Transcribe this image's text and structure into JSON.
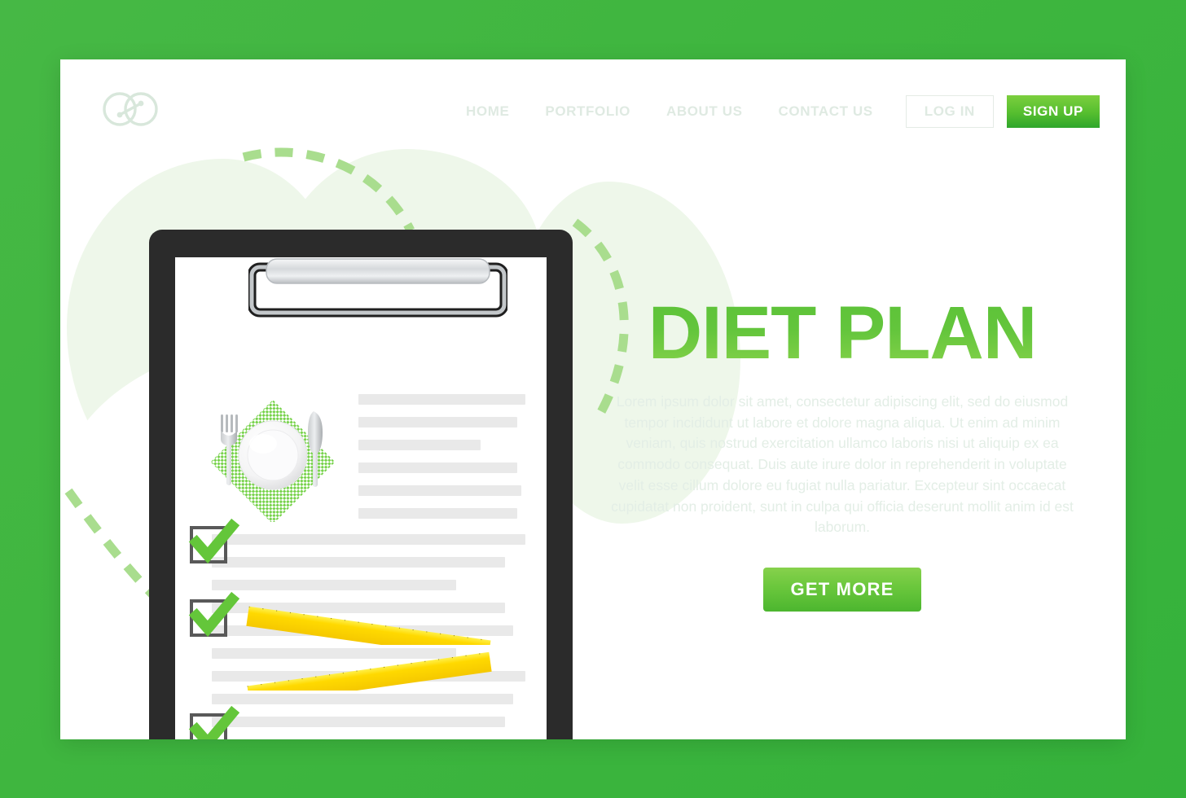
{
  "brand": {
    "logo_icon": "infinity-loop-logo"
  },
  "nav": {
    "items": [
      {
        "label": "HOME"
      },
      {
        "label": "PORTFOLIO"
      },
      {
        "label": "ABOUT US"
      },
      {
        "label": "CONTACT US"
      }
    ],
    "login_label": "LOG IN",
    "signup_label": "SIGN UP"
  },
  "hero": {
    "title": "DIET PLAN",
    "paragraph": "Lorem ipsum dolor sit amet, consectetur adipiscing elit, sed do eiusmod tempor incididunt ut labore et dolore magna aliqua. Ut enim ad minim veniam, quis nostrud exercitation ullamco laboris nisi ut aliquip ex ea commodo consequat. Duis aute irure dolor in reprehenderit in voluptate velit esse cillum dolore eu fugiat nulla pariatur. Excepteur sint occaecat cupidatat non proident, sunt in culpa qui officia deserunt mollit anim id est laborum.",
    "cta_label": "GET MORE"
  },
  "illustration": {
    "name": "diet-plan-clipboard",
    "clipboard_icon": "clipboard-icon",
    "plate_icon": "plate-icon",
    "fork_icon": "fork-icon",
    "knife_icon": "knife-icon",
    "napkin_icon": "checkered-napkin-icon",
    "checkmark_icon": "checkmark-icon",
    "measuring_tape_icon": "measuring-tape-icon",
    "checkbox_count": 3,
    "text_line_widths": [
      205,
      195,
      150,
      195,
      200,
      195,
      385,
      360,
      300,
      360,
      370,
      300,
      385,
      370,
      360
    ],
    "tape_count": 2
  },
  "colors": {
    "page_background": "#3fb63f",
    "accent_green": "#6ac73c",
    "heading_gradient_top": "#5cc238",
    "heading_gradient_bottom": "#86d24a",
    "muted_text": "#e3eee6",
    "blob_green": "#eef7ea",
    "dash_green": "#a9dd8e",
    "board_dark": "#2b2b2b",
    "tape_yellow": "#ffd900",
    "paper_line_gray": "#e9e9e9",
    "checkbox_border": "#595959"
  }
}
